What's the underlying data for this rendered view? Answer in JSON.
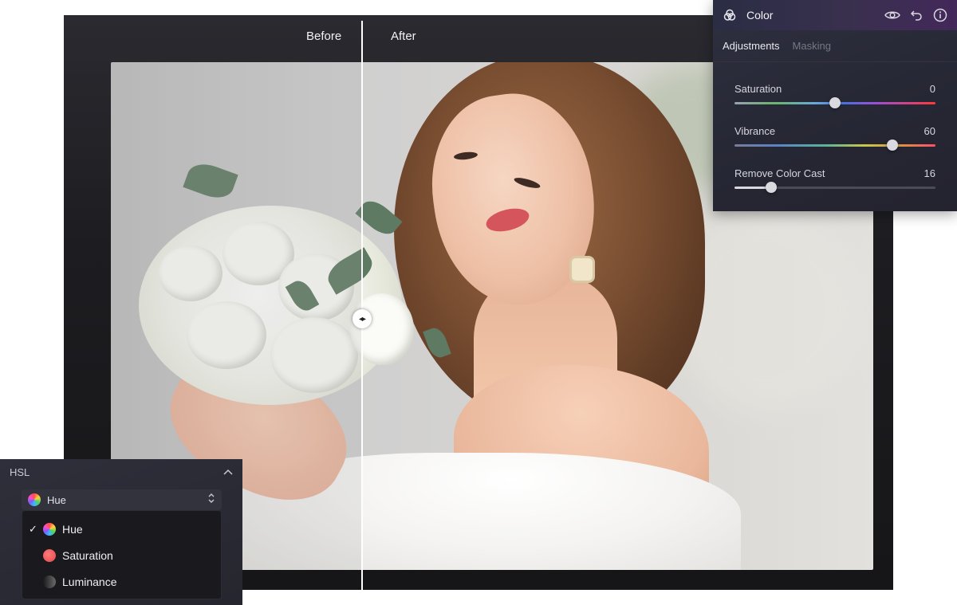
{
  "compare": {
    "before_label": "Before",
    "after_label": "After"
  },
  "color_panel": {
    "title": "Color",
    "icons": [
      "color-circles-icon",
      "eye-icon",
      "undo-icon",
      "info-icon"
    ],
    "tabs": [
      {
        "label": "Adjustments",
        "active": true
      },
      {
        "label": "Masking",
        "active": false
      }
    ],
    "sliders": [
      {
        "label": "Saturation",
        "value": "0",
        "fraction": 0.5
      },
      {
        "label": "Vibrance",
        "value": "60",
        "fraction": 0.785
      },
      {
        "label": "Remove Color Cast",
        "value": "16",
        "fraction": 0.184
      }
    ]
  },
  "hsl_panel": {
    "title": "HSL",
    "selected": "Hue",
    "options": [
      {
        "label": "Hue",
        "checked": true,
        "swatch": "hue"
      },
      {
        "label": "Saturation",
        "checked": false,
        "swatch": "saturation"
      },
      {
        "label": "Luminance",
        "checked": false,
        "swatch": "luminance"
      }
    ]
  },
  "colors": {
    "accent_purple": "#43285a",
    "panel_bg": "#272835",
    "menu_bg": "#19191e"
  }
}
